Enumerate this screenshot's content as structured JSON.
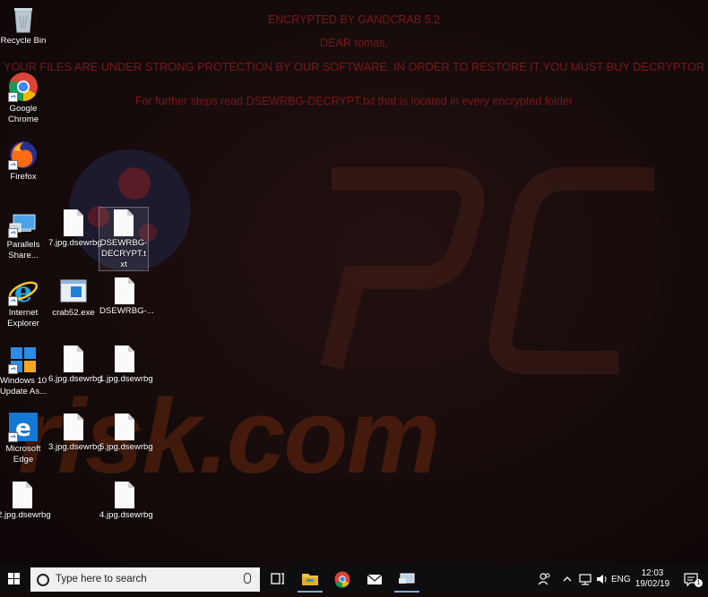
{
  "ransom_note": {
    "line1": "ENCRYPTED BY GANDCRAB 5.2",
    "line2": "DEAR tomas,",
    "line3": "YOUR FILES ARE UNDER STRONG PROTECTION BY OUR SOFTWARE. IN ORDER TO RESTORE IT YOU MUST BUY DECRYPTOR",
    "line4": "For further steps read DSEWRBG-DECRYPT.txt that is located in every encrypted folder"
  },
  "watermark": {
    "text": "risk.com"
  },
  "desktop_icons": {
    "recycle_bin": "Recycle Bin",
    "chrome": "Google Chrome",
    "firefox": "Firefox",
    "parallels": "Parallels Share...",
    "ie": "Internet Explorer",
    "win10": "Windows 10 Update As...",
    "edge": "Microsoft Edge",
    "file_7": "7.jpg.dsewrbg",
    "decrypt_txt": "DSEWRBG-DECRYPT.txt",
    "crab52": "crab52.exe",
    "decrypt_short": "DSEWRBG-...",
    "file_6": "6.jpg.dsewrbg",
    "file_1": "1.jpg.dsewrbg",
    "file_3": "3.jpg.dsewrbg",
    "file_5": "5.jpg.dsewrbg",
    "file_2": "2.jpg.dsewrbg",
    "file_4": "4.jpg.dsewrbg"
  },
  "taskbar": {
    "search_placeholder": "Type here to search",
    "language": "ENG",
    "time": "12:03",
    "date": "19/02/19",
    "notification_count": "1"
  }
}
